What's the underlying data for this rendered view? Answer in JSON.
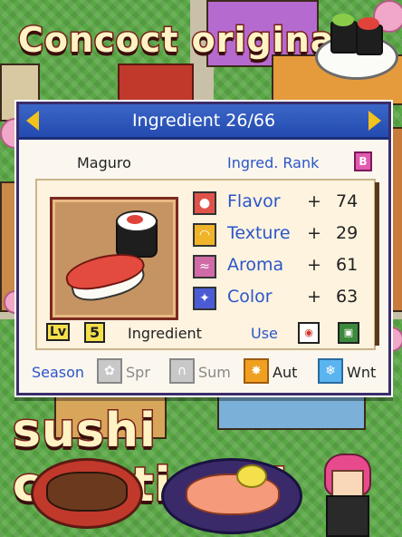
{
  "banner": {
    "top_text": "Concoct original",
    "bottom_text": "sushi creations!"
  },
  "dialog": {
    "title": "Ingredient 26/66",
    "nav_prev_icon": "arrow-left-icon",
    "nav_next_icon": "arrow-right-icon",
    "ingredient_name": "Maguro",
    "rank_label": "Ingred. Rank",
    "rank_value": "B",
    "stats": [
      {
        "name": "Flavor",
        "sign": "+",
        "value": "74",
        "icon": "flavor-icon",
        "color": "#e0534a"
      },
      {
        "name": "Texture",
        "sign": "+",
        "value": "29",
        "icon": "texture-icon",
        "color": "#f0b429"
      },
      {
        "name": "Aroma",
        "sign": "+",
        "value": "61",
        "icon": "aroma-icon",
        "color": "#d06ba8"
      },
      {
        "name": "Color",
        "sign": "+",
        "value": "63",
        "icon": "color-icon",
        "color": "#4b5bd6"
      }
    ],
    "level_label": "Lv",
    "level_value": "5",
    "category": "Ingredient",
    "use_label": "Use",
    "season_label": "Season",
    "seasons": [
      {
        "name": "Spr",
        "active": false,
        "icon": "flower-icon"
      },
      {
        "name": "Sum",
        "active": false,
        "icon": "wave-icon"
      },
      {
        "name": "Aut",
        "active": true,
        "icon": "maple-leaf-icon"
      },
      {
        "name": "Wnt",
        "active": true,
        "icon": "snowflake-icon"
      }
    ]
  },
  "colors": {
    "title_bar": "#2f5bc0",
    "accent_blue": "#2b55c9",
    "headline_fill": "#fff3c4",
    "headline_stroke": "#7a1f1a"
  }
}
